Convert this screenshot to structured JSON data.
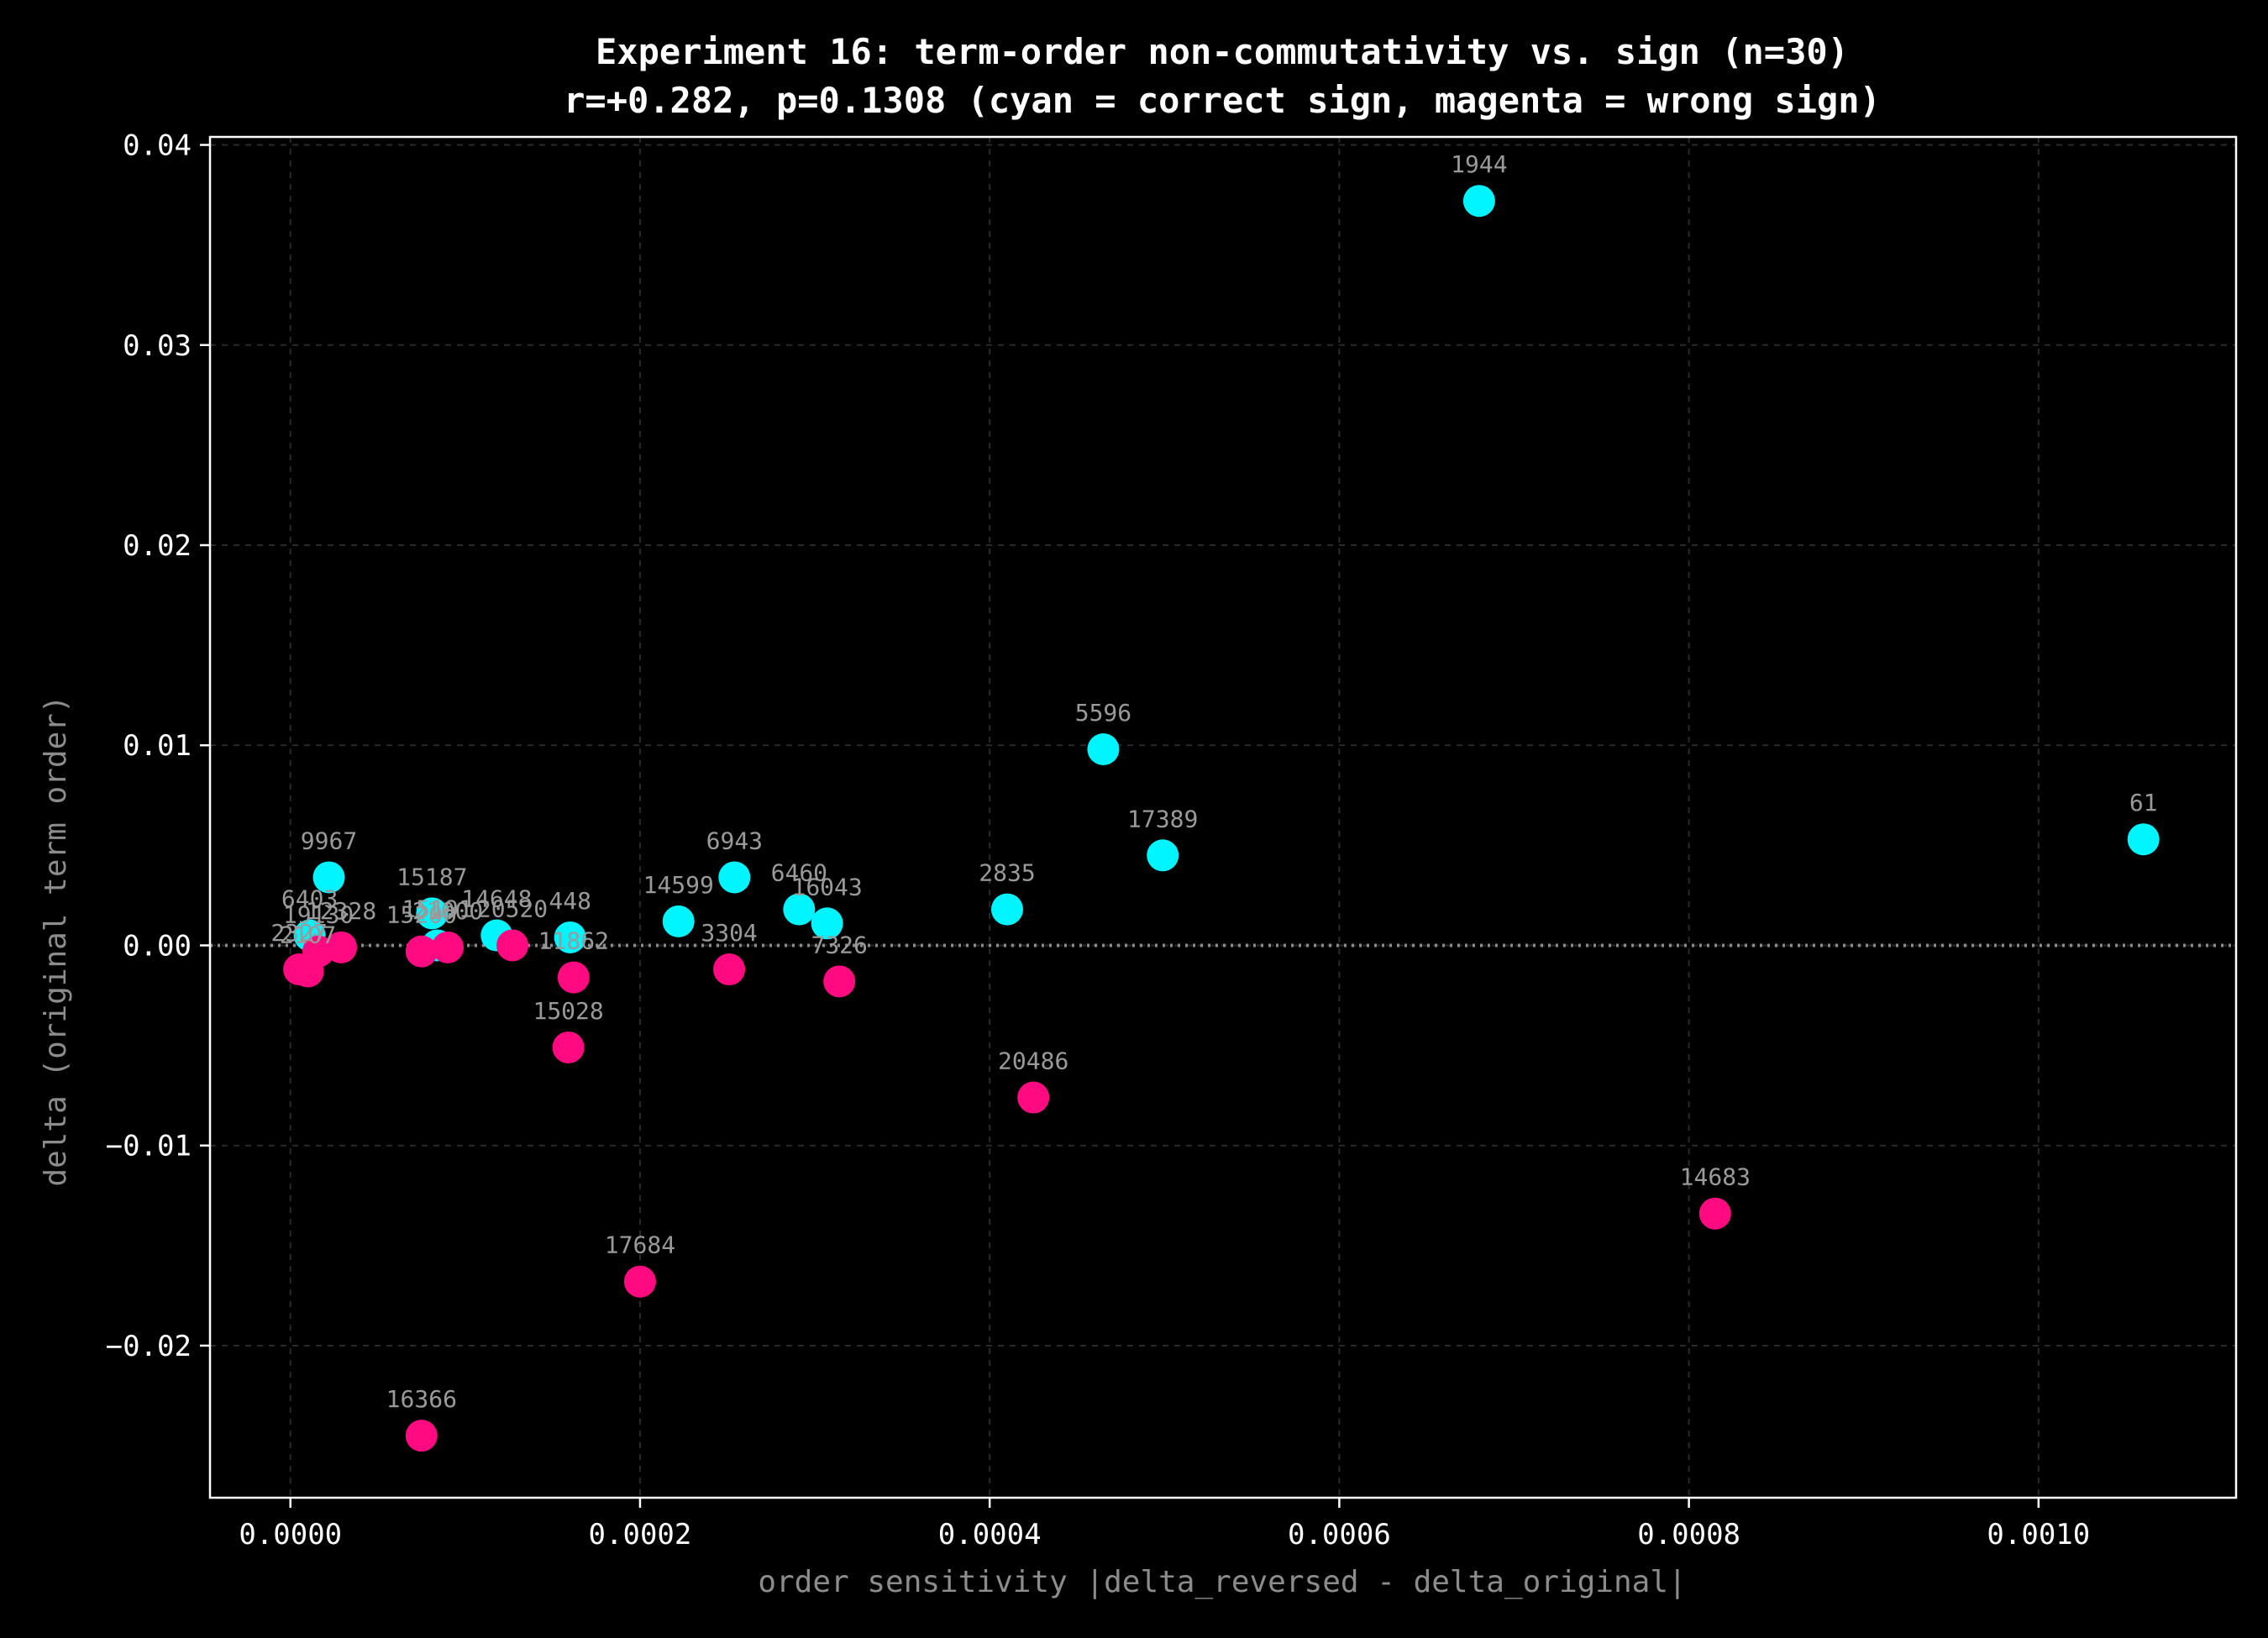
{
  "chart_data": {
    "type": "scatter",
    "title": "Experiment 16: term-order non-commutativity vs. sign (n=30)",
    "subtitle": "r=+0.282, p=0.1308 (cyan = correct sign, magenta = wrong sign)",
    "xlabel": "order sensitivity |delta_reversed - delta_original|",
    "ylabel": "delta (original term order)",
    "xlim": [
      -4.6e-05,
      0.001113
    ],
    "ylim": [
      -0.0276,
      0.0404
    ],
    "xticks": [
      0.0,
      0.0002,
      0.0004,
      0.0006,
      0.0008,
      0.001
    ],
    "xtick_labels": [
      "0.0000",
      "0.0002",
      "0.0004",
      "0.0006",
      "0.0008",
      "0.0010"
    ],
    "yticks": [
      -0.02,
      -0.01,
      0.0,
      0.01,
      0.02,
      0.03,
      0.04
    ],
    "ytick_labels": [
      "−0.02",
      "−0.01",
      "0.00",
      "0.01",
      "0.02",
      "0.03",
      "0.04"
    ],
    "grid": true,
    "reference_line_y": 0,
    "colors": {
      "correct": "#00f5ff",
      "wrong": "#ff0a80",
      "background": "#000000",
      "frame": "#ffffff",
      "grid": "#2a2a2a",
      "muted_text": "#8c8c8c"
    },
    "points": [
      {
        "label": "1944",
        "x": 0.00068,
        "y": 0.0372,
        "sign": "correct"
      },
      {
        "label": "5596",
        "x": 0.000465,
        "y": 0.0098,
        "sign": "correct"
      },
      {
        "label": "17389",
        "x": 0.000499,
        "y": 0.0045,
        "sign": "correct"
      },
      {
        "label": "61",
        "x": 0.00106,
        "y": 0.0053,
        "sign": "correct"
      },
      {
        "label": "2835",
        "x": 0.00041,
        "y": 0.0018,
        "sign": "correct"
      },
      {
        "label": "6943",
        "x": 0.000254,
        "y": 0.0034,
        "sign": "correct"
      },
      {
        "label": "6460",
        "x": 0.000291,
        "y": 0.0018,
        "sign": "correct"
      },
      {
        "label": "16043",
        "x": 0.000307,
        "y": 0.0011,
        "sign": "correct"
      },
      {
        "label": "14599",
        "x": 0.000222,
        "y": 0.0012,
        "sign": "correct"
      },
      {
        "label": "9967",
        "x": 2.2e-05,
        "y": 0.0034,
        "sign": "correct"
      },
      {
        "label": "15187",
        "x": 8.1e-05,
        "y": 0.0016,
        "sign": "correct"
      },
      {
        "label": "14648",
        "x": 0.000118,
        "y": 0.0005,
        "sign": "correct"
      },
      {
        "label": "448",
        "x": 0.00016,
        "y": 0.0004,
        "sign": "correct"
      },
      {
        "label": "6403",
        "x": 1.1e-05,
        "y": 0.0005,
        "sign": "correct"
      },
      {
        "label": "15191",
        "x": 8.4e-05,
        "y": 0.0,
        "sign": "correct"
      },
      {
        "label": "16366",
        "x": 7.5e-05,
        "y": -0.0245,
        "sign": "wrong"
      },
      {
        "label": "17684",
        "x": 0.0002,
        "y": -0.0168,
        "sign": "wrong"
      },
      {
        "label": "14683",
        "x": 0.000815,
        "y": -0.0134,
        "sign": "wrong"
      },
      {
        "label": "20486",
        "x": 0.000425,
        "y": -0.0076,
        "sign": "wrong"
      },
      {
        "label": "15028",
        "x": 0.000159,
        "y": -0.0051,
        "sign": "wrong"
      },
      {
        "label": "7326",
        "x": 0.000314,
        "y": -0.0018,
        "sign": "wrong"
      },
      {
        "label": "3304",
        "x": 0.000251,
        "y": -0.0012,
        "sign": "wrong"
      },
      {
        "label": "11862",
        "x": 0.000162,
        "y": -0.0016,
        "sign": "wrong"
      },
      {
        "label": "20520",
        "x": 0.000127,
        "y": 0.0,
        "sign": "wrong"
      },
      {
        "label": "21000",
        "x": 9e-05,
        "y": -0.0001,
        "sign": "wrong"
      },
      {
        "label": "15200",
        "x": 7.5e-05,
        "y": -0.0003,
        "sign": "wrong"
      },
      {
        "label": "12328",
        "x": 2.9e-05,
        "y": -0.0001,
        "sign": "wrong"
      },
      {
        "label": "19130",
        "x": 1.6e-05,
        "y": -0.0003,
        "sign": "wrong"
      },
      {
        "label": "2107",
        "x": 1e-05,
        "y": -0.0013,
        "sign": "wrong"
      },
      {
        "label": "2327",
        "x": 5e-06,
        "y": -0.0012,
        "sign": "wrong"
      }
    ]
  }
}
